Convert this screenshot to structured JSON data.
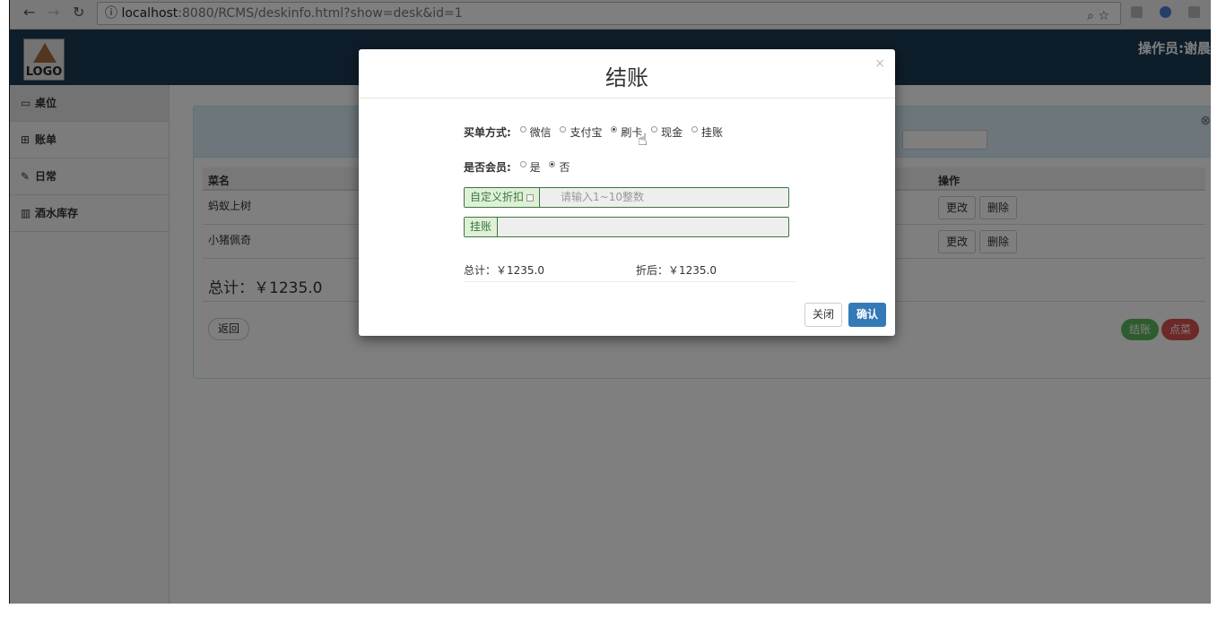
{
  "browser": {
    "url_host": "localhost",
    "url_path": ":8080/RCMS/deskinfo.html?show=desk&id=1"
  },
  "header": {
    "logo_text": "LOGO",
    "operator": "操作员:谢晨"
  },
  "sidebar": {
    "items": [
      {
        "label": "桌位",
        "icon": "monitor-icon"
      },
      {
        "label": "账单",
        "icon": "grid-icon"
      },
      {
        "label": "日常",
        "icon": "edit-icon"
      },
      {
        "label": "酒水库存",
        "icon": "barcode-icon"
      }
    ]
  },
  "table": {
    "headers": [
      "菜名",
      "操作"
    ],
    "rows": [
      {
        "name": "蚂蚁上树",
        "edit": "更改",
        "delete": "删除"
      },
      {
        "name": "小猪佩奇",
        "edit": "更改",
        "delete": "删除"
      }
    ]
  },
  "main": {
    "total": "总计：￥1235.0",
    "back_label": "返回",
    "pay_label": "结账",
    "order_label": "点菜"
  },
  "modal": {
    "title": "结账",
    "close_x": "×",
    "payment_label": "买单方式:",
    "payment_options": [
      "微信",
      "支付宝",
      "刷卡",
      "现金",
      "挂账"
    ],
    "payment_selected": "刷卡",
    "member_label": "是否会员:",
    "member_options": [
      "是",
      "否"
    ],
    "member_selected": "否",
    "discount_addon": "自定义折扣",
    "discount_placeholder": "请输入1~10整数",
    "credit_addon": "挂账",
    "credit_value": "",
    "sum_total": "总计：￥1235.0",
    "sum_after": "折后：￥1235.0",
    "close_label": "关闭",
    "confirm_label": "确认"
  }
}
